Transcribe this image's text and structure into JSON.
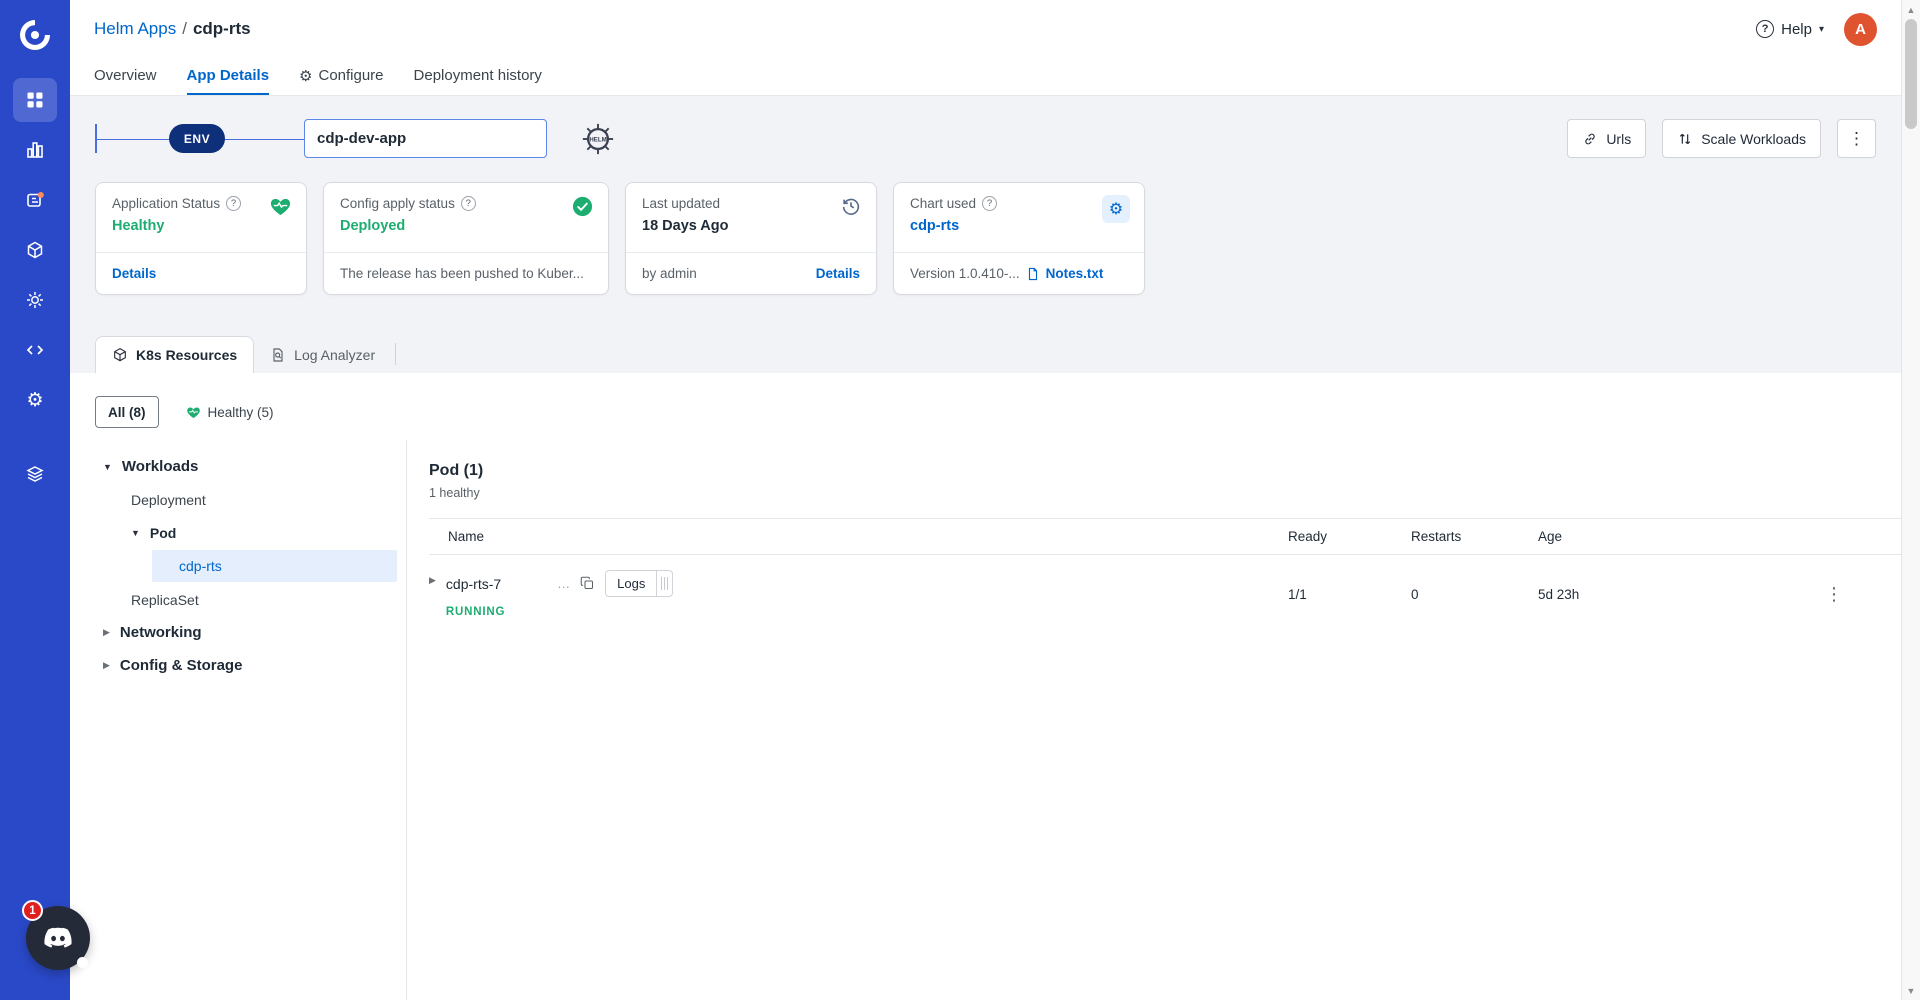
{
  "colors": {
    "accent": "#0066CC",
    "sidebar_bg": "#2A49C8",
    "success_green": "#1DAD70",
    "avatar_bg": "#E0532F",
    "notification_red": "#E02020",
    "env_pill_bg": "#0E2F7A",
    "selected_node_bg": "#E4EEFC"
  },
  "icons": {
    "gear": "⚙",
    "kebab": "⋮",
    "caret_down": "▼",
    "caret_right": "▶",
    "chevron_down": "▾",
    "question_mark": "?",
    "arrow_up": "▲",
    "arrow_down": "▼",
    "helm_text": "HELM"
  },
  "header": {
    "breadcrumb": {
      "section": "Helm Apps",
      "separator": "/",
      "app": "cdp-rts"
    },
    "help_label": "Help",
    "avatar_initial": "A"
  },
  "app_tabs": [
    {
      "label": "Overview"
    },
    {
      "label": "App Details"
    },
    {
      "label": "Configure"
    },
    {
      "label": "Deployment history"
    }
  ],
  "env_section": {
    "env_badge": "ENV",
    "app_name": "cdp-dev-app",
    "urls_button": "Urls",
    "scale_button": "Scale Workloads"
  },
  "status_cards": {
    "application_status": {
      "title": "Application Status",
      "value": "Healthy",
      "action": "Details"
    },
    "config_apply": {
      "title": "Config apply status",
      "value": "Deployed",
      "message": "The release has been pushed to Kuber..."
    },
    "last_updated": {
      "title": "Last updated",
      "value": "18 Days Ago",
      "by": "by admin",
      "action": "Details"
    },
    "chart_used": {
      "title": "Chart used",
      "value": "cdp-rts",
      "version": "Version 1.0.410-...",
      "notes": "Notes.txt"
    }
  },
  "resource_tabs": [
    {
      "label": "K8s Resources"
    },
    {
      "label": "Log Analyzer"
    }
  ],
  "filters": [
    {
      "label": "All (8)"
    },
    {
      "label": "Healthy (5)"
    }
  ],
  "tree": {
    "workloads": "Workloads",
    "deployment": "Deployment",
    "pod": "Pod",
    "pod_selected": "cdp-rts",
    "replicaset": "ReplicaSet",
    "networking": "Networking",
    "config_storage": "Config & Storage"
  },
  "pod_table": {
    "title": "Pod (1)",
    "subtitle": "1 healthy",
    "columns": {
      "name": "Name",
      "ready": "Ready",
      "restarts": "Restarts",
      "age": "Age"
    },
    "row": {
      "name": "cdp-rts-7",
      "truncation": "…",
      "logs_label": "Logs",
      "status": "RUNNING",
      "ready": "1/1",
      "restarts": "0",
      "age": "5d 23h"
    }
  },
  "chat": {
    "badge": "1"
  }
}
